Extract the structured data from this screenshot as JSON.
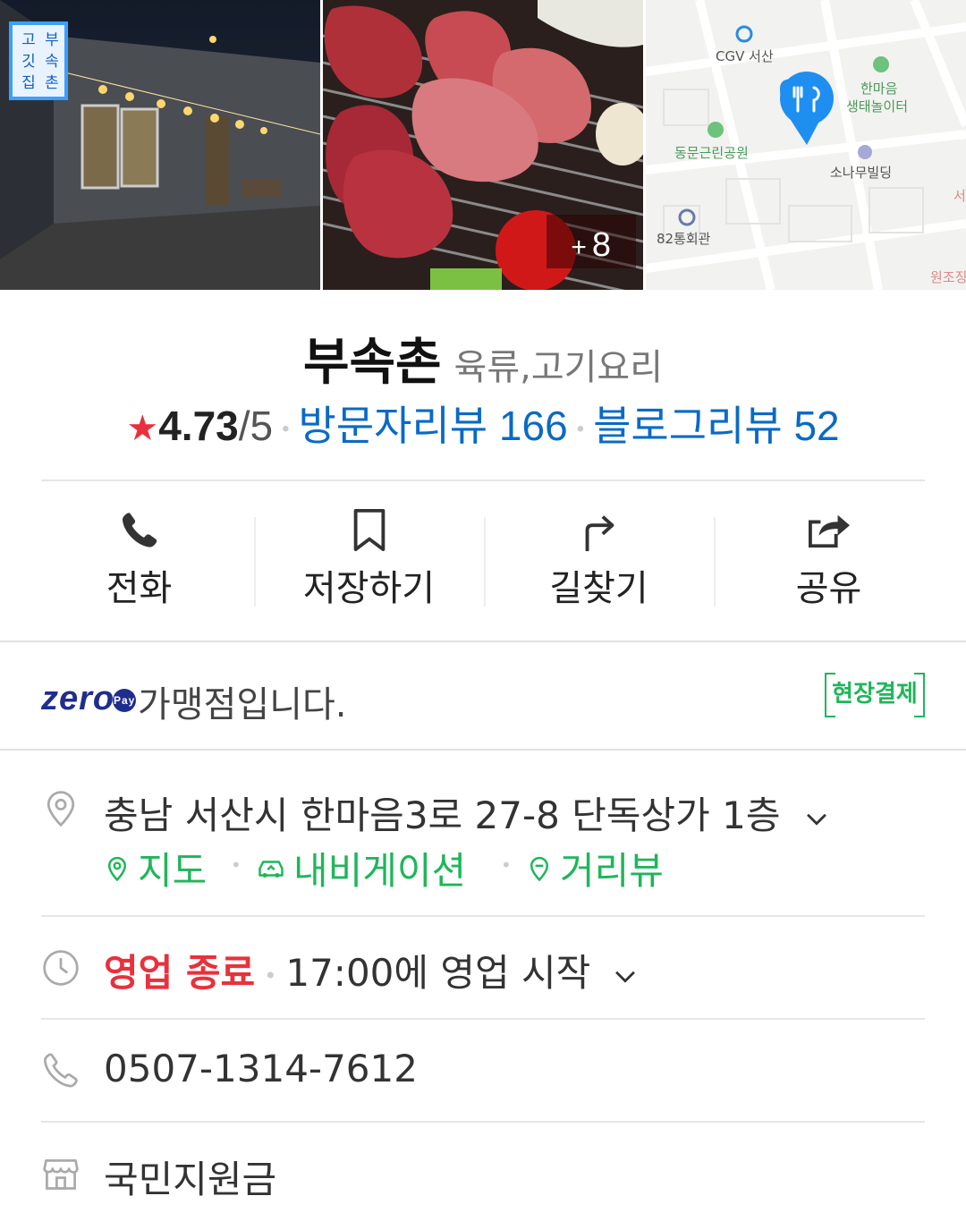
{
  "photos": {
    "more_count": "8",
    "shop_sign": [
      "고",
      "깃",
      "집",
      "부",
      "속",
      "촌"
    ],
    "map_labels": {
      "cgv": "CGV 서산",
      "park": "동문근린공원",
      "hanmaeum_line1": "한마음",
      "hanmaeum_line2": "생태놀이터",
      "sonamu": "소나무빌딩",
      "hall": "82통회관",
      "edge1": "원조징",
      "edge2": "서"
    }
  },
  "place": {
    "name": "부속촌",
    "category": "육류,고기요리",
    "rating": "4.73",
    "rating_max": "/5",
    "visitor_reviews": "방문자리뷰 166",
    "blog_reviews": "블로그리뷰 52"
  },
  "actions": [
    {
      "label": "전화",
      "icon": "phone-icon"
    },
    {
      "label": "저장하기",
      "icon": "bookmark-icon"
    },
    {
      "label": "길찾기",
      "icon": "directions-icon"
    },
    {
      "label": "공유",
      "icon": "share-icon"
    }
  ],
  "zeropay": {
    "logo": "zero",
    "logo_pay": "Pay",
    "text": "가맹점입니다.",
    "badge": "현장결제"
  },
  "address": {
    "text": "충남 서산시 한마음3로 27-8 단독상가 1층",
    "links": [
      "지도",
      "내비게이션",
      "거리뷰"
    ]
  },
  "hours": {
    "status": "영업 종료",
    "next": "17:00에 영업 시작"
  },
  "phone": "0507-1314-7612",
  "support": "국민지원금",
  "colors": {
    "blue": "#0a6ac5",
    "green": "#1fb65a",
    "red": "#e8313c",
    "zero_navy": "#1f2e8c"
  }
}
